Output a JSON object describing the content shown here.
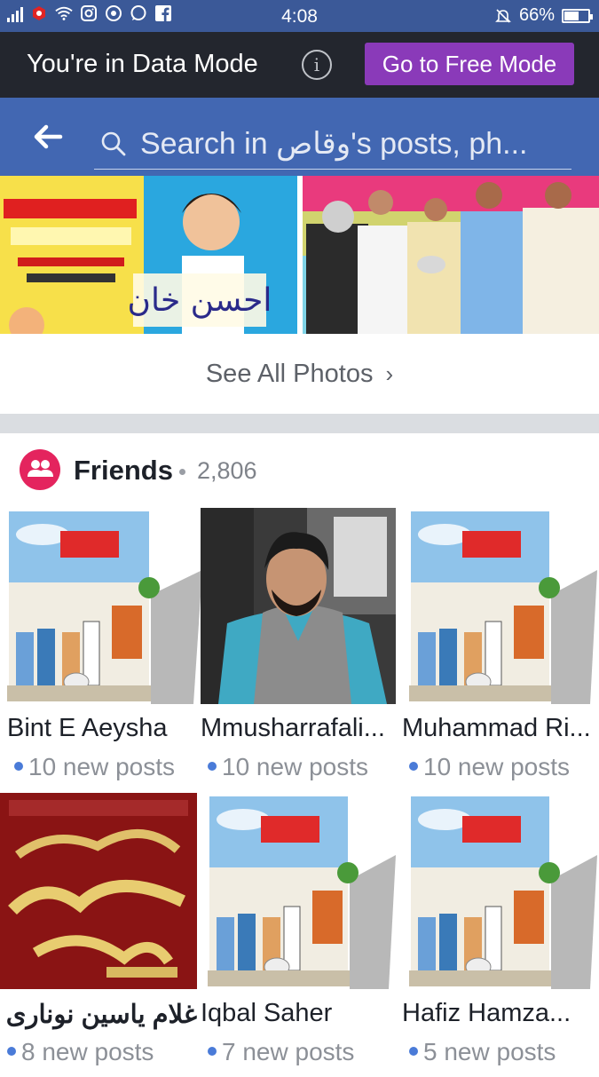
{
  "status_bar": {
    "time": "4:08",
    "battery": "66%",
    "battery_level": 0.66,
    "icons": [
      "signal-icon",
      "data-saver-icon",
      "wifi-icon",
      "instagram-icon",
      "chrome-icon",
      "whatsapp-icon",
      "facebook-icon",
      "silent-icon",
      "battery-icon"
    ]
  },
  "data_mode": {
    "message": "You're in Data Mode",
    "button_label": "Go to Free Mode"
  },
  "search": {
    "placeholder": "Search in وقاص's posts, ph..."
  },
  "photos": {
    "see_all_label": "See All Photos",
    "chevron": "›"
  },
  "friends": {
    "title": "Friends",
    "count": "2,806",
    "items": [
      {
        "name": "Bint E Aeysha",
        "posts": "10 new posts"
      },
      {
        "name": "Mmusharrafali...",
        "posts": "10 new posts"
      },
      {
        "name": "Muhammad Ri...",
        "posts": "10 new posts"
      },
      {
        "name": "غلام یاسین نوناری",
        "posts": "8 new posts"
      },
      {
        "name": "Iqbal Saher",
        "posts": "7 new posts"
      },
      {
        "name": "Hafiz Hamza...",
        "posts": "5 new posts"
      }
    ]
  },
  "colors": {
    "status_bar": "#3b5998",
    "data_bar": "#23262e",
    "free_mode_button": "#8a3ab9",
    "search_header": "#4267b2",
    "friends_icon": "#e4245e",
    "new_post_dot": "#4a7bd8"
  }
}
